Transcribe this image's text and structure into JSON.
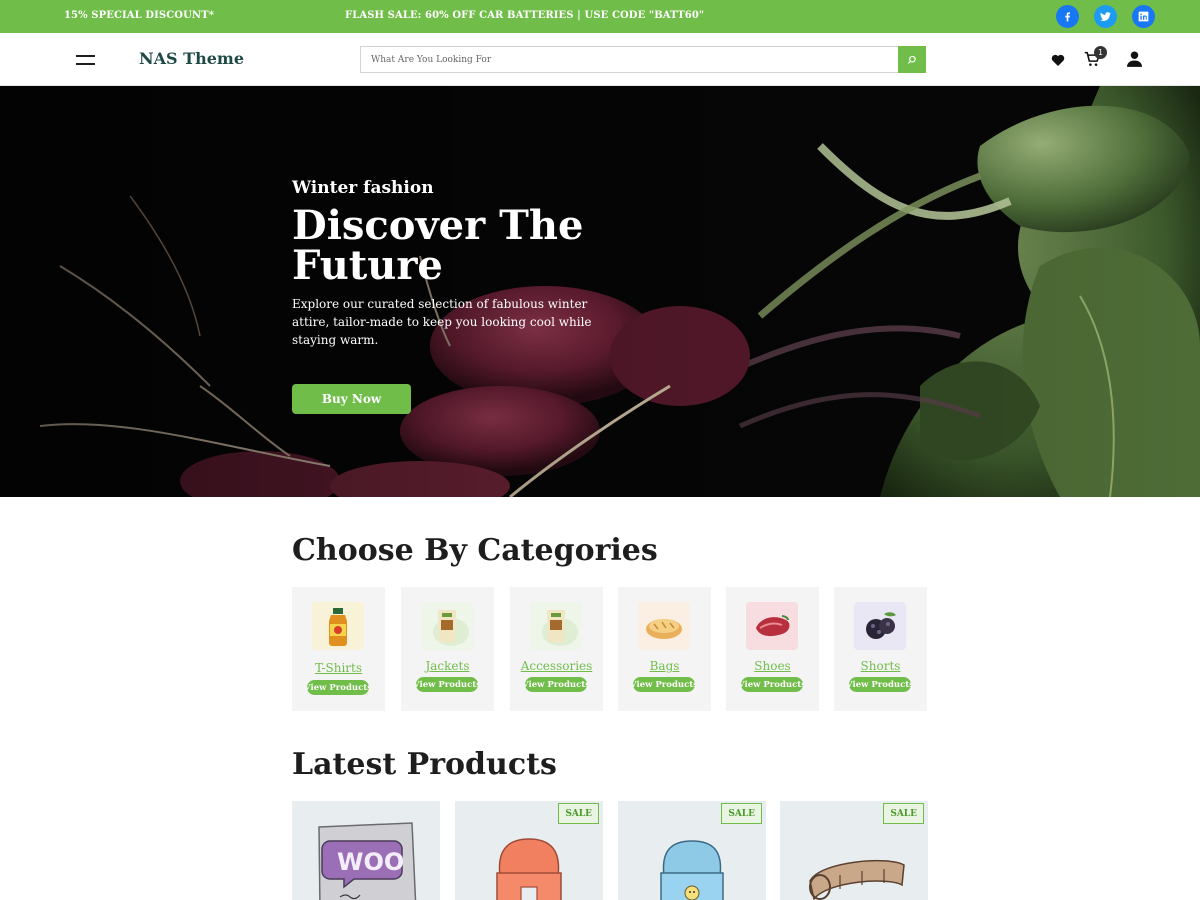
{
  "topbar": {
    "promo_left": "15% SPECIAL DISCOUNT*",
    "promo_center": "FLASH SALE: 60% OFF CAR BATTERIES | USE CODE \"BATT60\"",
    "social": [
      "facebook-icon",
      "twitter-icon",
      "linkedin-icon"
    ]
  },
  "header": {
    "logo": "NAS Theme",
    "search_placeholder": "What Are You Looking For",
    "cart_count": "1",
    "icons": [
      "menu-icon",
      "search-icon",
      "heart-icon",
      "cart-icon",
      "user-icon"
    ]
  },
  "hero": {
    "subtitle": "Winter fashion",
    "title": "Discover The Future",
    "description": "Explore our curated selection of fabulous winter attire, tailor-made to keep you looking cool while staying warm.",
    "button": "Buy Now"
  },
  "categories": {
    "title": "Choose By Categories",
    "button_label": "View Products",
    "items": [
      {
        "name": "T-Shirts",
        "icon": "juice-bottle-icon"
      },
      {
        "name": "Jackets",
        "icon": "snack-pack-icon"
      },
      {
        "name": "Accessories",
        "icon": "snack-pack-icon"
      },
      {
        "name": "Bags",
        "icon": "bread-icon"
      },
      {
        "name": "Shoes",
        "icon": "meat-icon"
      },
      {
        "name": "Shorts",
        "icon": "blackberry-icon"
      }
    ]
  },
  "latest": {
    "title": "Latest Products",
    "sale_label": "SALE",
    "products": [
      {
        "image": "woo-album-icon",
        "sale": false
      },
      {
        "image": "orange-beanie-icon",
        "sale": true
      },
      {
        "image": "blue-beanie-icon",
        "sale": true
      },
      {
        "image": "belt-icon",
        "sale": true
      }
    ]
  },
  "colors": {
    "accent": "#71bd4a",
    "logo": "#1d4a44",
    "text": "#1e1e1e"
  }
}
